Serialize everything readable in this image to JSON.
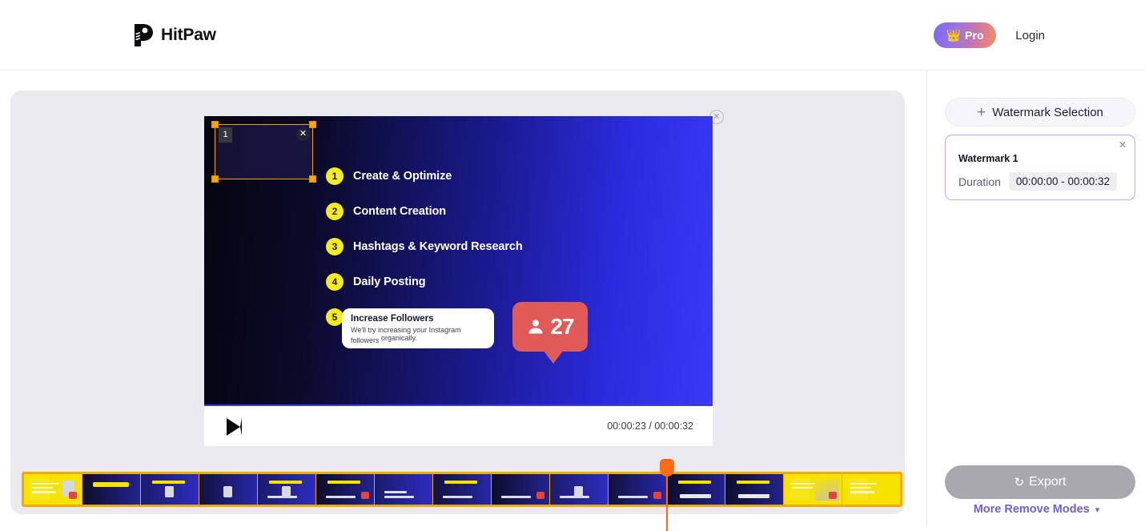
{
  "header": {
    "brand_name": "HitPaw",
    "logo_icon": "hitpaw-paw-logo",
    "pro_label": "Pro",
    "crown_icon": "crown-icon",
    "login_label": "Login",
    "pro_gradient_from": "#7b6af0",
    "pro_gradient_to": "#f2915f"
  },
  "editor": {
    "close_preview_icon": "close-circle-icon",
    "panel_bg": "#eaeaef",
    "video": {
      "accent_yellow": "#f6ec1b",
      "steps": [
        {
          "num": "1",
          "label": "Create & Optimize"
        },
        {
          "num": "2",
          "label": "Content Creation"
        },
        {
          "num": "3",
          "label": "Hashtags & Keyword Research"
        },
        {
          "num": "4",
          "label": "Daily Posting"
        },
        {
          "num": "5",
          "label": ""
        }
      ],
      "callout": {
        "title": "Increase Followers",
        "line1": "We'll try increasing your Instagram",
        "line2": "followers",
        "line2_tilt": "organically."
      },
      "follower_badge": {
        "icon": "person-icon",
        "count": "27",
        "color": "#e05a57"
      },
      "watermark_box": {
        "index_label": "1",
        "delete_icon": "close-icon",
        "border_color": "#f0a500"
      }
    },
    "player": {
      "play_icon": "play-icon",
      "current_time": "00:00:23",
      "total_time": "00:00:32",
      "time_display": "00:00:23 / 00:00:32"
    },
    "timeline": {
      "border_color": "#f5a800",
      "playhead_color": "#ff6a14",
      "playhead_icon": "playhead-marker"
    }
  },
  "sidebar": {
    "watermark_selection": {
      "plus_icon": "plus-icon",
      "label": "Watermark Selection"
    },
    "watermark_card": {
      "title": "Watermark 1",
      "close_icon": "close-icon",
      "duration_label": "Duration",
      "duration_value": "00:00:00 - 00:00:32",
      "border_color": "#b7aaf5"
    },
    "export": {
      "label": "Export",
      "spinner_icon": "loading-spinner-icon",
      "disabled": true,
      "bg": "#a8a8ae"
    },
    "more_modes": {
      "label": "More Remove Modes",
      "chevron_icon": "chevron-down-icon",
      "color": "#6c5ce8"
    }
  }
}
